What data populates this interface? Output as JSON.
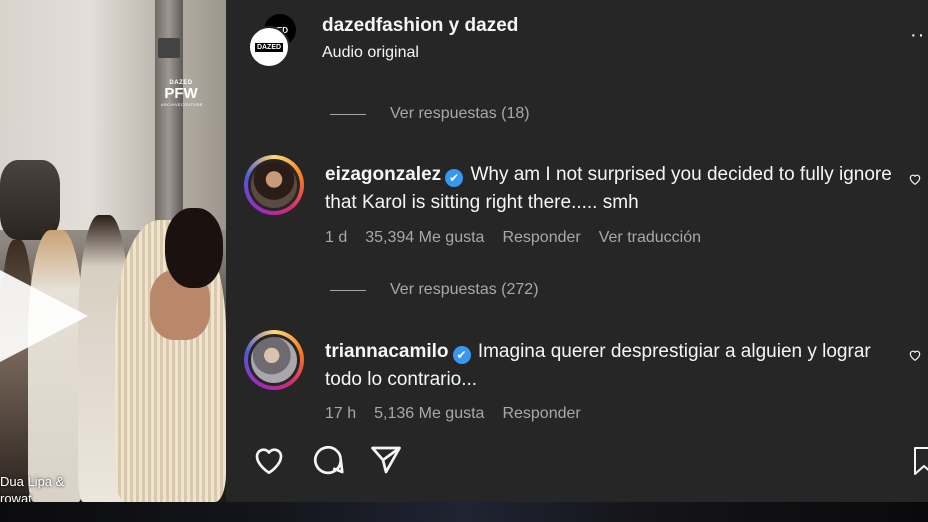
{
  "video": {
    "brand_small": "DAZED",
    "brand_big": "PFW",
    "brand_tiny": "ARCHIVECOUTURE",
    "caption_line1": "Dua Lipa &",
    "caption_line2": "rowat"
  },
  "post": {
    "header_title": "dazedfashion y dazed",
    "header_sub": "Audio original",
    "avatar_back_label": "ZED",
    "avatar_front_label": "DAZED"
  },
  "comments": [
    {
      "view_replies": "Ver respuestas (18)",
      "username": "eizagonzalez",
      "text": "Why am I not surprised you decided to fully ignore that Karol is sitting right there..... smh",
      "time": "1 d",
      "likes": "35,394 Me gusta",
      "reply": "Responder",
      "translate": "Ver traducción"
    },
    {
      "view_replies": "Ver respuestas (272)",
      "username": "triannacamilo",
      "text": "Imagina querer desprestigiar a alguien y lograr todo lo contrario...",
      "time": "17 h",
      "likes": "5,136 Me gusta",
      "reply": "Responder"
    }
  ],
  "icons": {
    "verified": "✔",
    "more": "··"
  },
  "colors": {
    "panel_bg": "#262626",
    "secondary_text": "#a8a8a8",
    "verified_blue": "#3897f0"
  }
}
